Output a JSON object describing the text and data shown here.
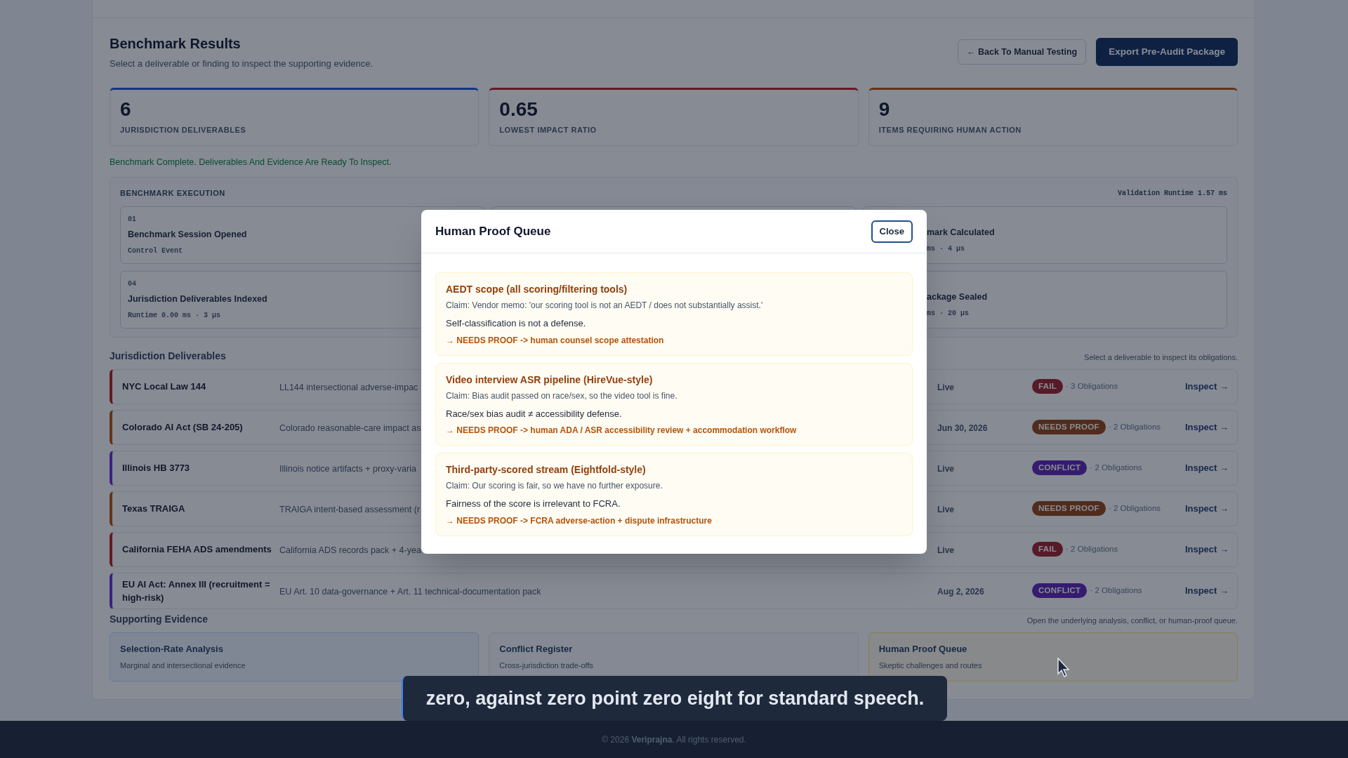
{
  "header": {
    "title": "Benchmark Results",
    "subtitle": "Select a deliverable or finding to inspect the supporting evidence.",
    "back_button": "← Back To Manual Testing",
    "export_button": "Export Pre-Audit Package"
  },
  "stats": [
    {
      "value": "6",
      "label": "JURISDICTION DELIVERABLES"
    },
    {
      "value": "0.65",
      "label": "LOWEST IMPACT RATIO"
    },
    {
      "value": "9",
      "label": "ITEMS REQUIRING HUMAN ACTION"
    }
  ],
  "status_message": "Benchmark Complete. Deliverables And Evidence Are Ready To Inspect.",
  "execution": {
    "title": "BENCHMARK EXECUTION",
    "runtime": "Validation Runtime 1.57 ms",
    "left_steps": [
      {
        "number": "01",
        "title": "Benchmark Session Opened",
        "detail": "Control Event"
      },
      {
        "number": "04",
        "title": "Jurisdiction Deliverables Indexed",
        "detail": "Runtime 0.00 ms · 3 µs"
      }
    ],
    "right_steps": [
      {
        "title": "mark Calculated",
        "detail": "ms · 4 µs"
      },
      {
        "title": "ackage Sealed",
        "detail": "ms · 20 µs"
      }
    ]
  },
  "deliverables": {
    "title": "Jurisdiction Deliverables",
    "hint": "Select a deliverable to inspect its obligations.",
    "rows": [
      {
        "name": "NYC Local Law 144",
        "description": "LL144 intersectional adverse-impac",
        "date": "Live",
        "status": "FAIL",
        "kind": "fail",
        "obligations": "· 3 Obligations",
        "action": "Inspect →"
      },
      {
        "name": "Colorado AI Act (SB 24-205)",
        "description": "Colorado reasonable-care impact as",
        "date": "Jun 30, 2026",
        "status": "NEEDS PROOF",
        "kind": "needs_proof",
        "obligations": "· 2 Obligations",
        "action": "Inspect →"
      },
      {
        "name": "Illinois HB 3773",
        "description": "Illinois notice artifacts + proxy-varia",
        "date": "Live",
        "status": "CONFLICT",
        "kind": "conflict",
        "obligations": "· 2 Obligations",
        "action": "Inspect →"
      },
      {
        "name": "Texas TRAIGA",
        "description": "TRAIGA intent-based assessment (r",
        "date": "Live",
        "status": "NEEDS PROOF",
        "kind": "needs_proof",
        "obligations": "· 2 Obligations",
        "action": "Inspect →"
      },
      {
        "name": "California FEHA ADS amendments",
        "description": "California ADS records pack + 4-yea",
        "date": "Live",
        "status": "FAIL",
        "kind": "fail",
        "obligations": "· 2 Obligations",
        "action": "Inspect →"
      },
      {
        "name": "EU AI Act: Annex III (recruitment = high-risk)",
        "description": "EU Art. 10 data-governance + Art. 11 technical-documentation pack",
        "date": "Aug 2, 2026",
        "status": "CONFLICT",
        "kind": "conflict",
        "obligations": "· 2 Obligations",
        "action": "Inspect →"
      }
    ]
  },
  "evidence": {
    "title": "Supporting Evidence",
    "hint": "Open the underlying analysis, conflict, or human-proof queue.",
    "cards": [
      {
        "title": "Selection-Rate Analysis",
        "subtitle": "Marginal and intersectional evidence",
        "kind": "analysis"
      },
      {
        "title": "Conflict Register",
        "subtitle": "Cross-jurisdiction trade-offs",
        "kind": "conflict"
      },
      {
        "title": "Human Proof Queue",
        "subtitle": "Skeptic challenges and routes",
        "kind": "proof"
      }
    ]
  },
  "modal": {
    "title": "Human Proof Queue",
    "close_button": "Close",
    "items": [
      {
        "title": "AEDT scope (all scoring/filtering tools)",
        "claim": "Claim: Vendor memo: 'our scoring tool is not an AEDT / does not substantially assist.'",
        "verdict": "Self-classification is not a defense.",
        "route": "→ NEEDS PROOF -> human counsel scope attestation"
      },
      {
        "title": "Video interview ASR pipeline (HireVue-style)",
        "claim": "Claim: Bias audit passed on race/sex, so the video tool is fine.",
        "verdict": "Race/sex bias audit ≠ accessibility defense.",
        "route": "→ NEEDS PROOF -> human ADA / ASR accessibility review + accommodation workflow"
      },
      {
        "title": "Third-party-scored stream (Eightfold-style)",
        "claim": "Claim: Our scoring is fair, so we have no further exposure.",
        "verdict": "Fairness of the score is irrelevant to FCRA.",
        "route": "→ NEEDS PROOF -> FCRA adverse-action + dispute infrastructure"
      }
    ]
  },
  "caption": "zero, against zero point zero eight for standard speech.",
  "footer": "© 2026 **Veriprajna**. All rights reserved."
}
